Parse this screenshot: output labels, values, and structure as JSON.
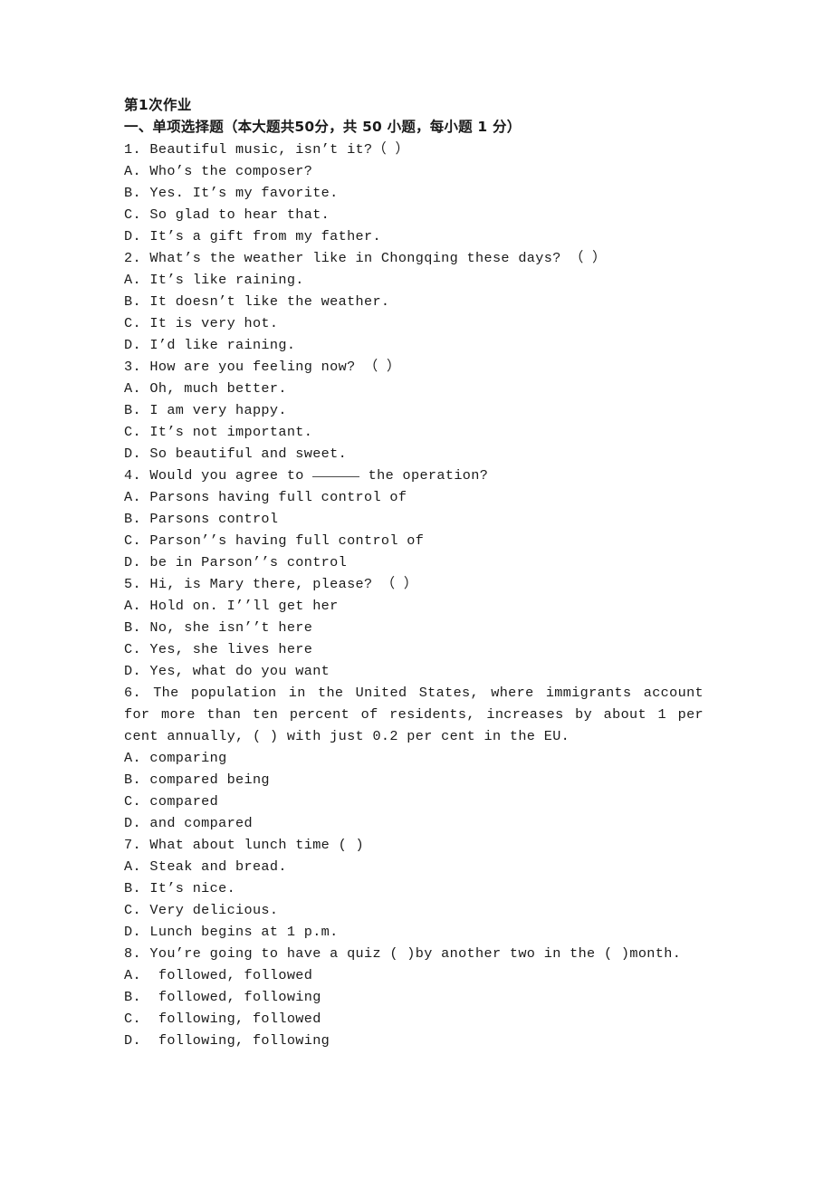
{
  "document": {
    "title": "第1次作业",
    "section_heading": "一、单项选择题（本大题共50分，共 50 小题，每小题 1 分）"
  },
  "questions": [
    {
      "number": "1.",
      "stem": "1. Beautiful music, isn’t it?（ ）",
      "options": [
        "A. Who’s the composer?",
        "B. Yes. It’s my favorite.",
        "C. So glad to hear that.",
        "D. It’s a gift from my father."
      ]
    },
    {
      "number": "2.",
      "stem": "2. What’s the weather like in Chongqing these days? （ ）",
      "options": [
        "A. It’s like raining.",
        "B. It doesn’t like the weather.",
        "C. It is very hot.",
        "D. I’d like raining."
      ]
    },
    {
      "number": "3.",
      "stem": "3. How are you feeling now? （ ）",
      "options": [
        "A. Oh, much better.",
        "B. I am very happy.",
        "C. It’s not important.",
        "D. So beautiful and sweet."
      ]
    },
    {
      "number": "4.",
      "stem_before_blank": "4. Would you agree to ",
      "stem_after_blank": " the operation?",
      "options": [
        "A. Parsons having full control of",
        "B. Parsons control",
        "C. Parson’’s having full control of",
        "D. be in Parson’’s control"
      ]
    },
    {
      "number": "5.",
      "stem": "5. Hi, is Mary there, please? （ ）",
      "options": [
        "A. Hold on. I’’ll get her",
        "B. No, she isn’’t here",
        "C. Yes, she lives here",
        "D. Yes, what do you want"
      ]
    },
    {
      "number": "6.",
      "stem": "6. The population in the United States, where immigrants account for more than ten percent of residents, increases by about 1 per cent annually, ( ) with just 0.2 per cent in the EU.",
      "options": [
        "A. comparing",
        "B. compared being",
        "C. compared",
        "D. and compared"
      ]
    },
    {
      "number": "7.",
      "stem": "7. What about lunch time ( )",
      "options": [
        "A. Steak and bread.",
        "B. It’s nice.",
        "C. Very delicious.",
        "D. Lunch begins at 1 p.m."
      ]
    },
    {
      "number": "8.",
      "stem": "8. You’re going to have a quiz ( )by another two in the ( )month.",
      "options": [
        "A.  followed, followed",
        "B.  followed, following",
        "C.  following, followed",
        "D.  following, following"
      ]
    }
  ]
}
